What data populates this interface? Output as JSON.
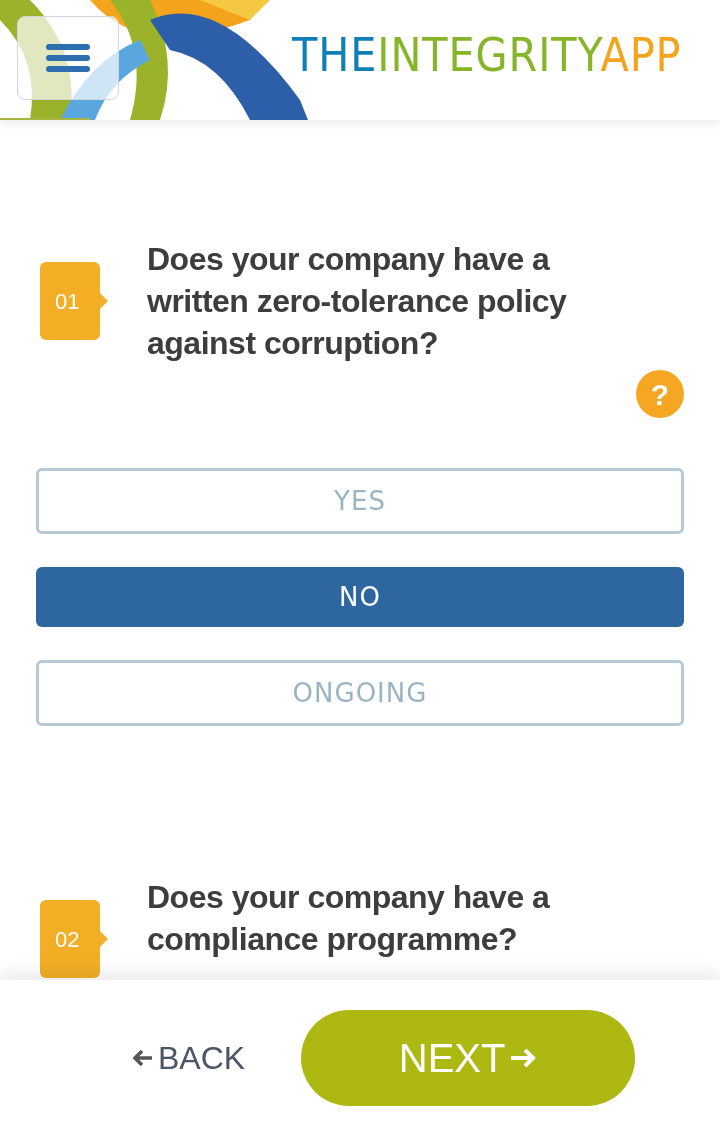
{
  "header": {
    "logo": [
      {
        "text": "THE",
        "color": "#0f7fb8"
      },
      {
        "text": "INTEGRITY",
        "color": "#86b52a"
      },
      {
        "text": "APP",
        "color": "#f3a41c"
      }
    ]
  },
  "questions": [
    {
      "number": "01",
      "text": "Does your company have a written zero-tolerance policy against corruption?",
      "help": "?",
      "options": [
        {
          "label": "YES",
          "selected": false
        },
        {
          "label": "NO",
          "selected": true
        },
        {
          "label": "ONGOING",
          "selected": false
        }
      ]
    },
    {
      "number": "02",
      "text": "Does your company have a compliance programme?"
    }
  ],
  "footer": {
    "back": "BACK",
    "next": "NEXT"
  }
}
